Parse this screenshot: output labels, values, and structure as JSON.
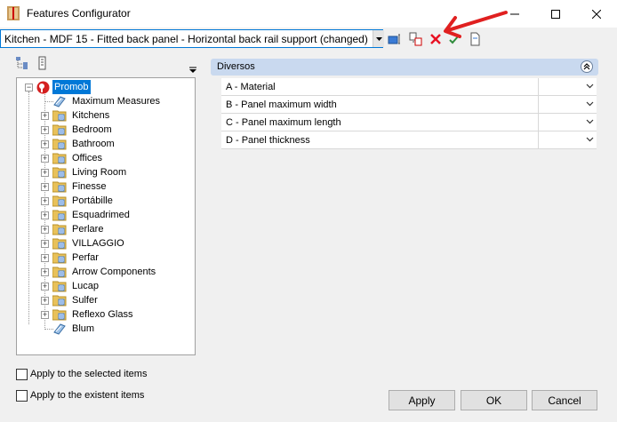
{
  "window": {
    "title": "Features Configurator",
    "app_icon": "configurator-app-icon",
    "controls": [
      "minimize-icon",
      "maximize-icon",
      "close-icon"
    ]
  },
  "config": {
    "selected": "Kitchen - MDF 15 - Fitted back panel - Horizontal back rail support (changed)"
  },
  "toolbar": {
    "icons": [
      "apply-to-items-icon",
      "copy-config-icon",
      "delete-icon",
      "confirm-icon",
      "new-document-icon"
    ],
    "delete_color": "#e81123",
    "annotation_arrow_color": "#e02020"
  },
  "tree_toolbar": {
    "icons": [
      "tree-view-icon",
      "list-view-icon",
      "dropdown-arrow-icon"
    ]
  },
  "tree": {
    "root": "Promob",
    "items": [
      {
        "label": "Maximum Measures",
        "expandable": false,
        "icon": "feature-tag-icon"
      },
      {
        "label": "Kitchens",
        "expandable": true,
        "icon": "folder-icon"
      },
      {
        "label": "Bedroom",
        "expandable": true,
        "icon": "folder-icon"
      },
      {
        "label": "Bathroom",
        "expandable": true,
        "icon": "folder-icon"
      },
      {
        "label": "Offices",
        "expandable": true,
        "icon": "folder-icon"
      },
      {
        "label": "Living Room",
        "expandable": true,
        "icon": "folder-icon"
      },
      {
        "label": "Finesse",
        "expandable": true,
        "icon": "folder-icon"
      },
      {
        "label": "Portábille",
        "expandable": true,
        "icon": "folder-icon"
      },
      {
        "label": "Esquadrimed",
        "expandable": true,
        "icon": "folder-icon"
      },
      {
        "label": "Perlare",
        "expandable": true,
        "icon": "folder-icon"
      },
      {
        "label": "VILLAGGIO",
        "expandable": true,
        "icon": "folder-icon"
      },
      {
        "label": "Perfar",
        "expandable": true,
        "icon": "folder-icon"
      },
      {
        "label": "Arrow Components",
        "expandable": true,
        "icon": "folder-icon"
      },
      {
        "label": "Lucap",
        "expandable": true,
        "icon": "folder-icon"
      },
      {
        "label": "Sulfer",
        "expandable": true,
        "icon": "folder-icon"
      },
      {
        "label": "Reflexo Glass",
        "expandable": true,
        "icon": "folder-icon"
      },
      {
        "label": "Blum",
        "expandable": false,
        "icon": "feature-tag-icon"
      }
    ]
  },
  "panel": {
    "title": "Diversos",
    "properties": [
      {
        "label": "A - Material",
        "value": ""
      },
      {
        "label": "B - Panel maximum width",
        "value": ""
      },
      {
        "label": "C - Panel maximum length",
        "value": ""
      },
      {
        "label": "D - Panel thickness",
        "value": ""
      }
    ]
  },
  "options": {
    "apply_selected": "Apply to the selected items",
    "apply_existent": "Apply to the existent items",
    "apply_selected_checked": false,
    "apply_existent_checked": false
  },
  "buttons": {
    "apply": "Apply",
    "ok": "OK",
    "cancel": "Cancel"
  }
}
